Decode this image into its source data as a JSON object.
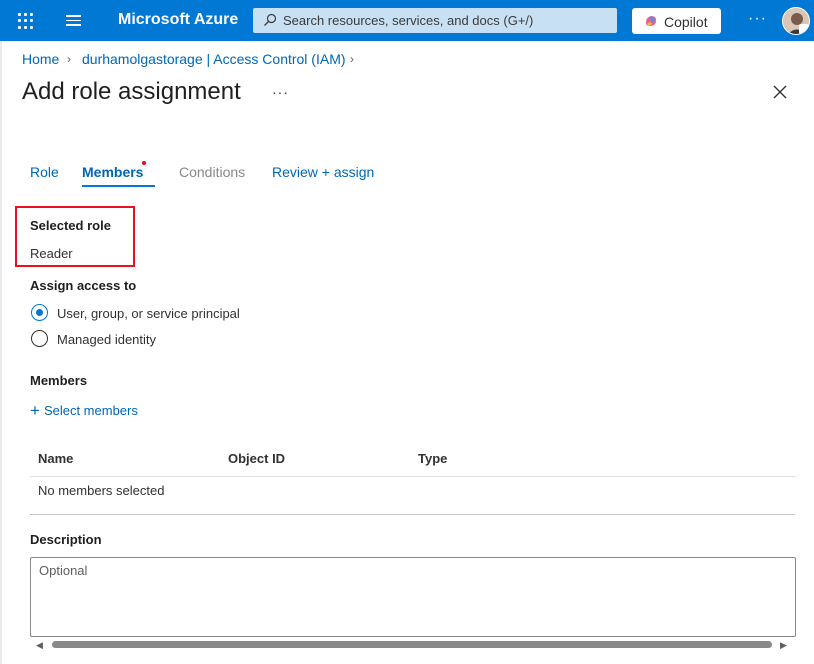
{
  "topbar": {
    "brand": "Microsoft Azure",
    "search_placeholder": "Search resources, services, and docs (G+/)",
    "copilot_label": "Copilot",
    "more_label": "···",
    "accent": "#0078d4"
  },
  "breadcrumb": {
    "items": [
      "Home",
      "durhamolgastorage | Access Control (IAM)"
    ]
  },
  "page": {
    "title": "Add role assignment",
    "more_label": "···"
  },
  "tabs": [
    {
      "label": "Role",
      "state": "link"
    },
    {
      "label": "Members",
      "state": "active"
    },
    {
      "label": "Conditions",
      "state": "disabled"
    },
    {
      "label": "Review + assign",
      "state": "link"
    }
  ],
  "selected_role": {
    "label": "Selected role",
    "value": "Reader"
  },
  "assign_access": {
    "label": "Assign access to",
    "options": [
      {
        "label": "User, group, or service principal",
        "checked": true
      },
      {
        "label": "Managed identity",
        "checked": false
      }
    ]
  },
  "members": {
    "label": "Members",
    "add_link": "Select members",
    "columns": [
      "Name",
      "Object ID",
      "Type"
    ],
    "empty_text": "No members selected"
  },
  "description": {
    "label": "Description",
    "placeholder": "Optional"
  }
}
